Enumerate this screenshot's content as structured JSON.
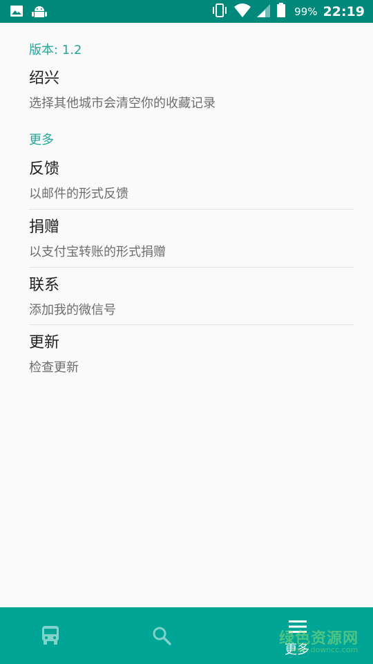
{
  "status_bar": {
    "battery_percent": "99%",
    "time": "22:19",
    "icons": [
      "image-icon",
      "android-icon",
      "vibrate-icon",
      "wifi-icon",
      "signal-icon",
      "battery-icon"
    ]
  },
  "settings": {
    "version_header": "版本: 1.2",
    "city": {
      "title": "绍兴",
      "summary": "选择其他城市会清空你的收藏记录"
    },
    "more_header": "更多",
    "items": [
      {
        "title": "反馈",
        "summary": "以邮件的形式反馈"
      },
      {
        "title": "捐赠",
        "summary": "以支付宝转账的形式捐赠"
      },
      {
        "title": "联系",
        "summary": "添加我的微信号"
      },
      {
        "title": "更新",
        "summary": "检查更新"
      }
    ]
  },
  "bottom_nav": {
    "items": [
      {
        "icon": "bus-icon",
        "label": ""
      },
      {
        "icon": "search-icon",
        "label": ""
      },
      {
        "icon": "menu-icon",
        "label": "更多"
      }
    ],
    "active_index": 2
  },
  "watermark": {
    "text": "绿色资源网",
    "sub": "www.downcc.com"
  },
  "colors": {
    "primary": "#00897b",
    "nav": "#00a596",
    "accent": "#26a69a"
  }
}
